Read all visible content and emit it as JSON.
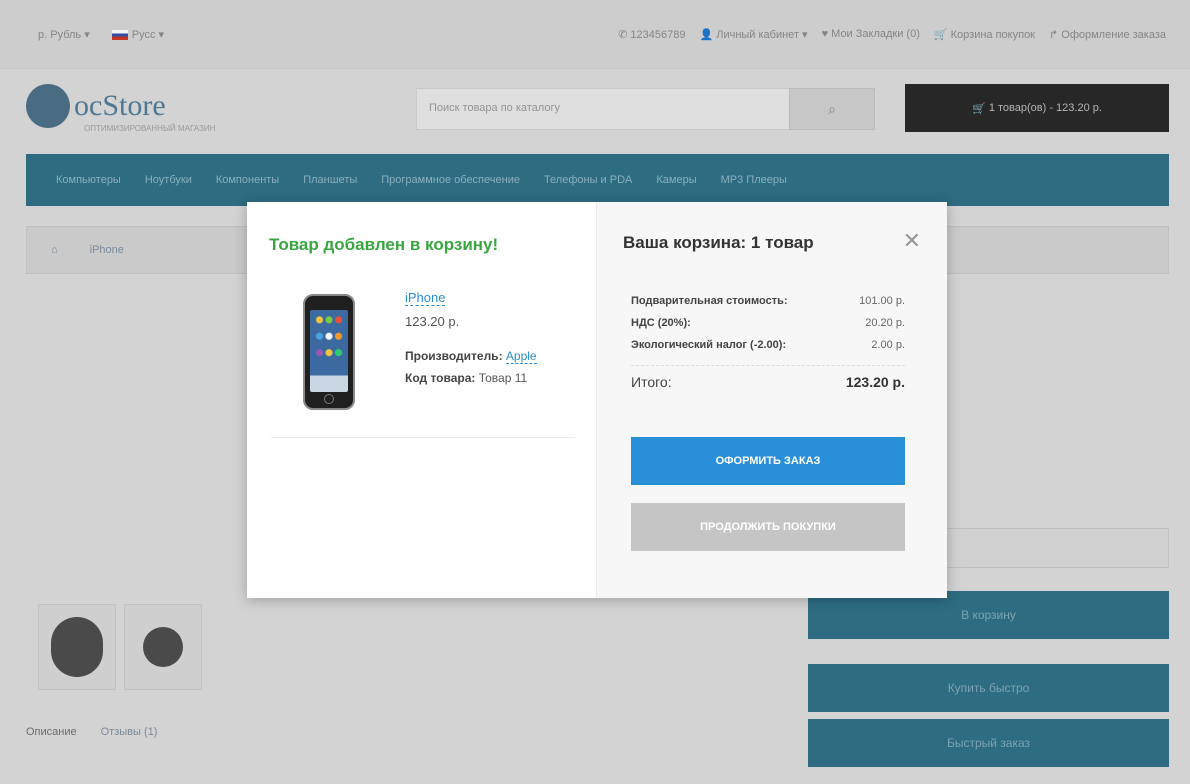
{
  "header": {
    "currency": "р. Рубль ▾",
    "language": "Русс ▾",
    "phone": "123456789",
    "account": "Личный кабинет ▾",
    "wishlist": "Мои Закладки (0)",
    "cart_link": "Корзина покупок",
    "checkout_link": "Оформление заказа"
  },
  "logo": {
    "name": "ocStore",
    "tagline": "ОПТИМИЗИРОВАННЫЙ МАГАЗИН"
  },
  "search": {
    "placeholder": "Поиск товара по каталогу"
  },
  "cart_button": "1 товар(ов) - 123.20 р.",
  "menu": [
    "Компьютеры",
    "Ноутбуки",
    "Компоненты",
    "Планшеты",
    "Программное обеспечение",
    "Телефоны и PDA",
    "Камеры",
    "MP3 Плееры"
  ],
  "breadcrumb": {
    "current": "iPhone"
  },
  "product_tabs": {
    "description": "Описание",
    "reviews": "Отзывы (1)"
  },
  "buttons": {
    "add_to_cart": "В корзину",
    "buy_fast": "Купить быстро",
    "quick_order": "Быстрый заказ"
  },
  "modal": {
    "added_title": "Товар добавлен в корзину!",
    "product": {
      "name": "iPhone",
      "price": "123.20 р.",
      "manufacturer_label": "Производитель:",
      "manufacturer": "Apple",
      "code_label": "Код товара:",
      "code": "Товар 11"
    },
    "cart_title": "Ваша корзина: 1 товар",
    "totals": [
      {
        "label": "Подварительная стоимость:",
        "value": "101.00 р."
      },
      {
        "label": "НДС (20%):",
        "value": "20.20 р."
      },
      {
        "label": "Экологический налог (-2.00):",
        "value": "2.00 р."
      }
    ],
    "grand_total": {
      "label": "Итого:",
      "value": "123.20 р."
    },
    "checkout_button": "ОФОРМИТЬ ЗАКАЗ",
    "continue_button": "ПРОДОЛЖИТЬ ПОКУПКИ"
  }
}
